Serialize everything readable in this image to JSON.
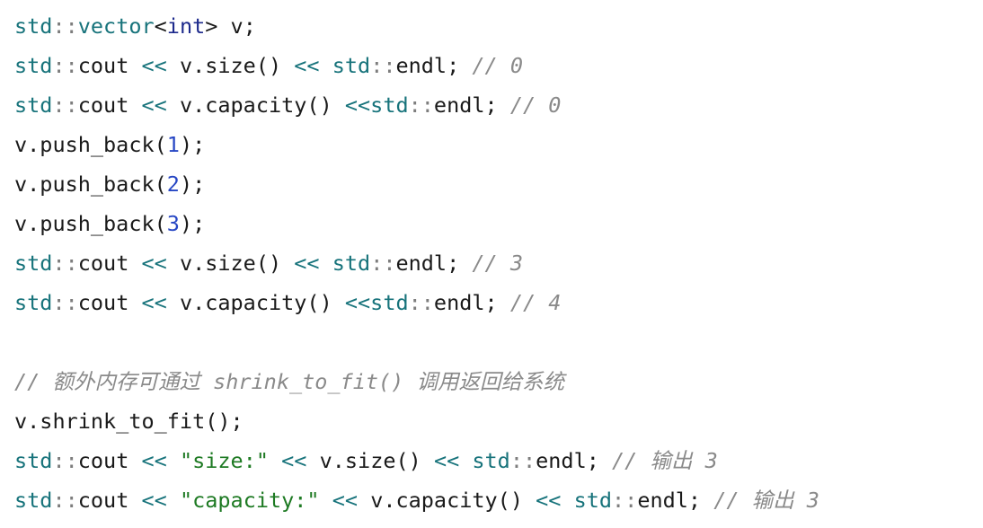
{
  "code": {
    "lines": [
      [
        {
          "t": "std",
          "k": "ns"
        },
        {
          "t": "::",
          "k": "sep"
        },
        {
          "t": "vector",
          "k": "ns"
        },
        {
          "t": "<",
          "k": "plain"
        },
        {
          "t": "int",
          "k": "type"
        },
        {
          "t": "> v;",
          "k": "plain"
        }
      ],
      [
        {
          "t": "std",
          "k": "ns"
        },
        {
          "t": "::",
          "k": "sep"
        },
        {
          "t": "cout ",
          "k": "plain"
        },
        {
          "t": "<<",
          "k": "op"
        },
        {
          "t": " v.size() ",
          "k": "plain"
        },
        {
          "t": "<<",
          "k": "op"
        },
        {
          "t": " ",
          "k": "plain"
        },
        {
          "t": "std",
          "k": "ns"
        },
        {
          "t": "::",
          "k": "sep"
        },
        {
          "t": "endl; ",
          "k": "plain"
        },
        {
          "t": "// 0",
          "k": "comment"
        }
      ],
      [
        {
          "t": "std",
          "k": "ns"
        },
        {
          "t": "::",
          "k": "sep"
        },
        {
          "t": "cout ",
          "k": "plain"
        },
        {
          "t": "<<",
          "k": "op"
        },
        {
          "t": " v.capacity() ",
          "k": "plain"
        },
        {
          "t": "<<",
          "k": "op"
        },
        {
          "t": "std",
          "k": "ns"
        },
        {
          "t": "::",
          "k": "sep"
        },
        {
          "t": "endl; ",
          "k": "plain"
        },
        {
          "t": "// 0",
          "k": "comment"
        }
      ],
      [
        {
          "t": "v.push_back(",
          "k": "plain"
        },
        {
          "t": "1",
          "k": "num"
        },
        {
          "t": ");",
          "k": "plain"
        }
      ],
      [
        {
          "t": "v.push_back(",
          "k": "plain"
        },
        {
          "t": "2",
          "k": "num"
        },
        {
          "t": ");",
          "k": "plain"
        }
      ],
      [
        {
          "t": "v.push_back(",
          "k": "plain"
        },
        {
          "t": "3",
          "k": "num"
        },
        {
          "t": ");",
          "k": "plain"
        }
      ],
      [
        {
          "t": "std",
          "k": "ns"
        },
        {
          "t": "::",
          "k": "sep"
        },
        {
          "t": "cout ",
          "k": "plain"
        },
        {
          "t": "<<",
          "k": "op"
        },
        {
          "t": " v.size() ",
          "k": "plain"
        },
        {
          "t": "<<",
          "k": "op"
        },
        {
          "t": " ",
          "k": "plain"
        },
        {
          "t": "std",
          "k": "ns"
        },
        {
          "t": "::",
          "k": "sep"
        },
        {
          "t": "endl; ",
          "k": "plain"
        },
        {
          "t": "// 3",
          "k": "comment"
        }
      ],
      [
        {
          "t": "std",
          "k": "ns"
        },
        {
          "t": "::",
          "k": "sep"
        },
        {
          "t": "cout ",
          "k": "plain"
        },
        {
          "t": "<<",
          "k": "op"
        },
        {
          "t": " v.capacity() ",
          "k": "plain"
        },
        {
          "t": "<<",
          "k": "op"
        },
        {
          "t": "std",
          "k": "ns"
        },
        {
          "t": "::",
          "k": "sep"
        },
        {
          "t": "endl; ",
          "k": "plain"
        },
        {
          "t": "// 4",
          "k": "comment"
        }
      ],
      [],
      [
        {
          "t": "// 额外内存可通过 shrink_to_fit() 调用返回给系统",
          "k": "comment"
        }
      ],
      [
        {
          "t": "v.shrink_to_fit();",
          "k": "plain"
        }
      ],
      [
        {
          "t": "std",
          "k": "ns"
        },
        {
          "t": "::",
          "k": "sep"
        },
        {
          "t": "cout ",
          "k": "plain"
        },
        {
          "t": "<<",
          "k": "op"
        },
        {
          "t": " ",
          "k": "plain"
        },
        {
          "t": "\"size:\"",
          "k": "str"
        },
        {
          "t": " ",
          "k": "plain"
        },
        {
          "t": "<<",
          "k": "op"
        },
        {
          "t": " v.size() ",
          "k": "plain"
        },
        {
          "t": "<<",
          "k": "op"
        },
        {
          "t": " ",
          "k": "plain"
        },
        {
          "t": "std",
          "k": "ns"
        },
        {
          "t": "::",
          "k": "sep"
        },
        {
          "t": "endl; ",
          "k": "plain"
        },
        {
          "t": "// 输出 3",
          "k": "comment"
        }
      ],
      [
        {
          "t": "std",
          "k": "ns"
        },
        {
          "t": "::",
          "k": "sep"
        },
        {
          "t": "cout ",
          "k": "plain"
        },
        {
          "t": "<<",
          "k": "op"
        },
        {
          "t": " ",
          "k": "plain"
        },
        {
          "t": "\"capacity:\"",
          "k": "str"
        },
        {
          "t": " ",
          "k": "plain"
        },
        {
          "t": "<<",
          "k": "op"
        },
        {
          "t": " v.capacity() ",
          "k": "plain"
        },
        {
          "t": "<<",
          "k": "op"
        },
        {
          "t": " ",
          "k": "plain"
        },
        {
          "t": "std",
          "k": "ns"
        },
        {
          "t": "::",
          "k": "sep"
        },
        {
          "t": "endl; ",
          "k": "plain"
        },
        {
          "t": "// 输出 3",
          "k": "comment"
        }
      ]
    ]
  },
  "colors": {
    "background": "#ffffff",
    "plain": "#1a1a1a",
    "namespace": "#17737b",
    "separator": "#7d7d7d",
    "type_keyword": "#1d2a8c",
    "operator": "#17737b",
    "number": "#2646c4",
    "string": "#1e7a23",
    "comment": "#8a8a8a"
  }
}
